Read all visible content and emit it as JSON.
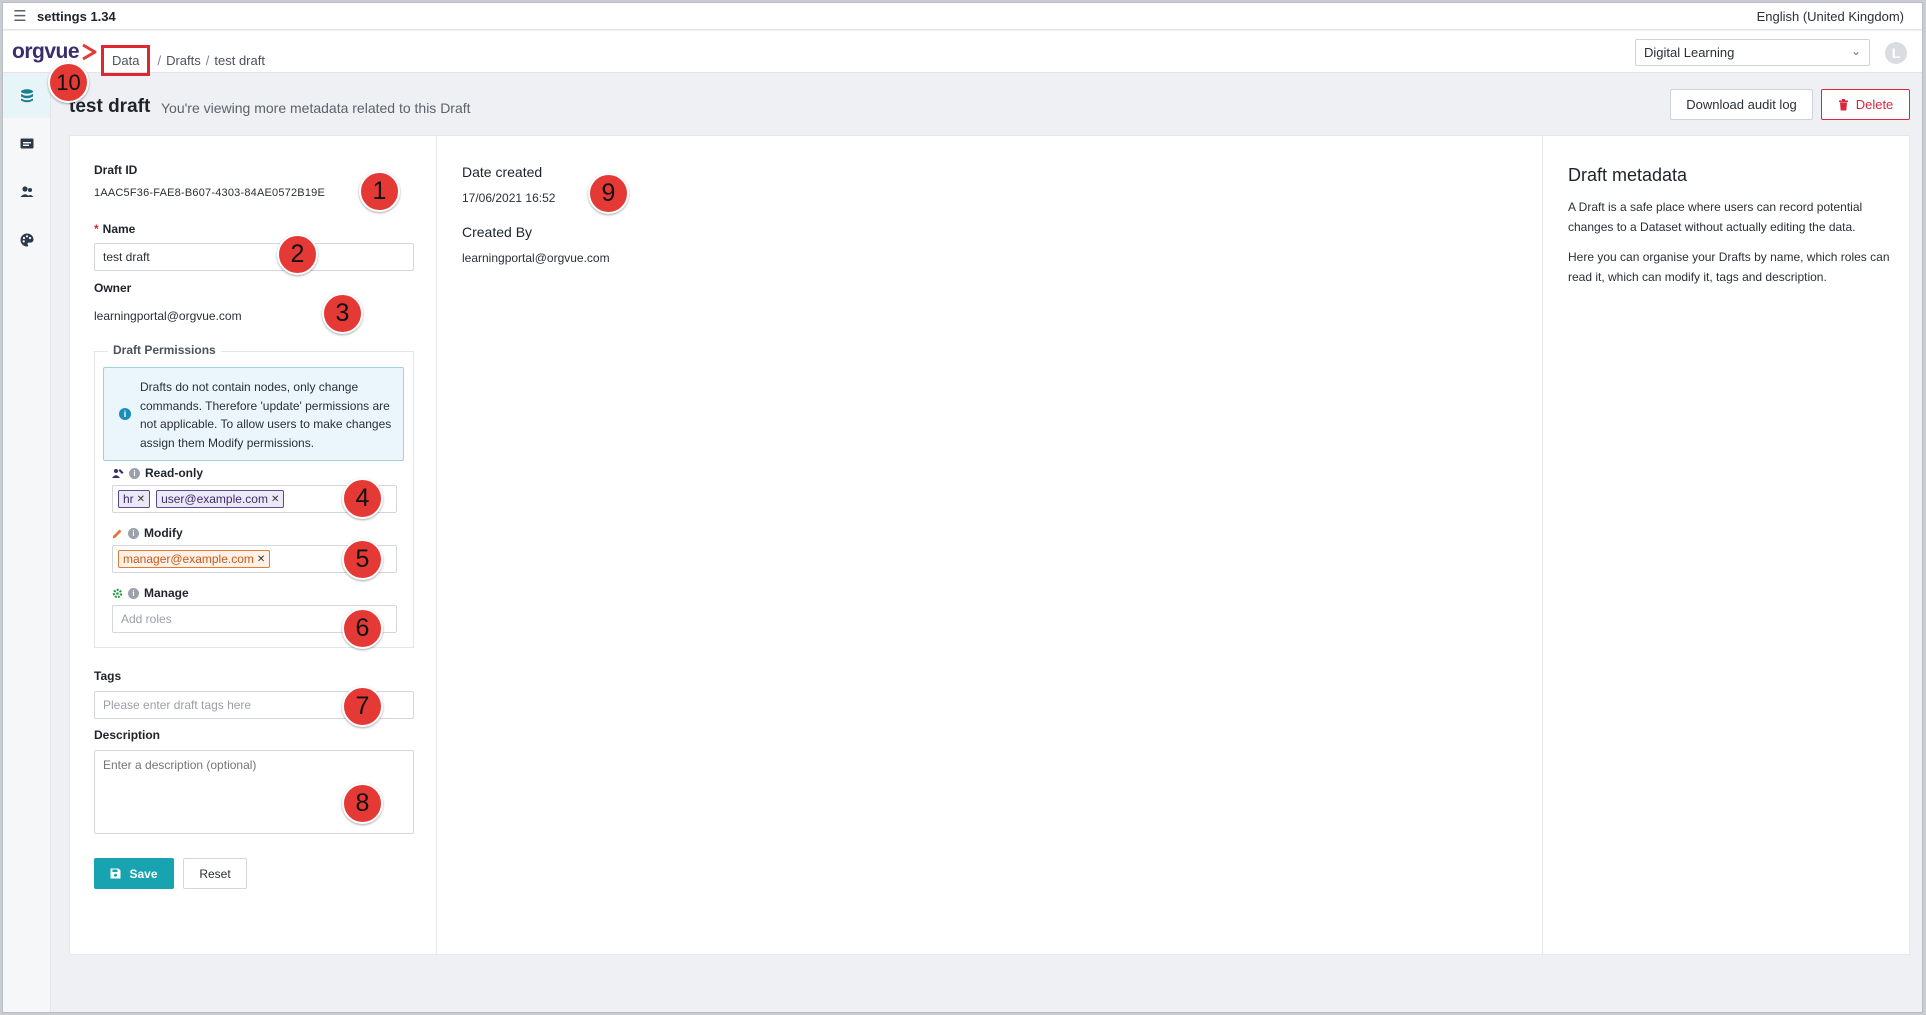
{
  "window": {
    "title": "settings 1.34",
    "language": "English (United Kingdom)"
  },
  "header": {
    "logo_text": "orgvue",
    "breadcrumb": [
      "Data",
      "Drafts",
      "test draft"
    ],
    "workspace": "Digital Learning",
    "avatar_initial": "L"
  },
  "nav": [
    "database-icon",
    "browser-icon",
    "people-icon",
    "palette-icon"
  ],
  "page": {
    "title": "test draft",
    "subtitle": "You're viewing more metadata related to this Draft",
    "download_label": "Download audit log",
    "delete_label": "Delete"
  },
  "form": {
    "draft_id_label": "Draft ID",
    "draft_id": "1AAC5F36-FAE8-B607-4303-84AE0572B19E",
    "name_label": "Name",
    "name_value": "test draft",
    "owner_label": "Owner",
    "owner_value": "learningportal@orgvue.com",
    "permissions_label": "Draft Permissions",
    "permissions_info": "Drafts do not contain nodes, only change commands. Therefore 'update' permissions are not applicable. To allow users to make changes assign them Modify permissions.",
    "readonly_label": "Read-only",
    "readonly_tags": [
      "hr",
      "user@example.com"
    ],
    "modify_label": "Modify",
    "modify_tags": [
      "manager@example.com"
    ],
    "manage_label": "Manage",
    "manage_placeholder": "Add roles",
    "tags_label": "Tags",
    "tags_placeholder": "Please enter draft tags here",
    "description_label": "Description",
    "description_placeholder": "Enter a description (optional)",
    "save_label": "Save",
    "reset_label": "Reset"
  },
  "details": {
    "date_created_label": "Date created",
    "date_created": "17/06/2021 16:52",
    "created_by_label": "Created By",
    "created_by": "learningportal@orgvue.com"
  },
  "metadata": {
    "title": "Draft metadata",
    "p1": "A Draft is a safe place where users can record potential changes to a Dataset without actually editing the data.",
    "p2": "Here you can organise your Drafts by name, which roles can read it, which can modify it, tags and description."
  },
  "markers": [
    "1",
    "2",
    "3",
    "4",
    "5",
    "6",
    "7",
    "8",
    "9",
    "10"
  ],
  "colors": {
    "accent": "#17a3b0",
    "danger": "#d7263d",
    "brand": "#3a2d6d",
    "marker": "#e53935"
  }
}
